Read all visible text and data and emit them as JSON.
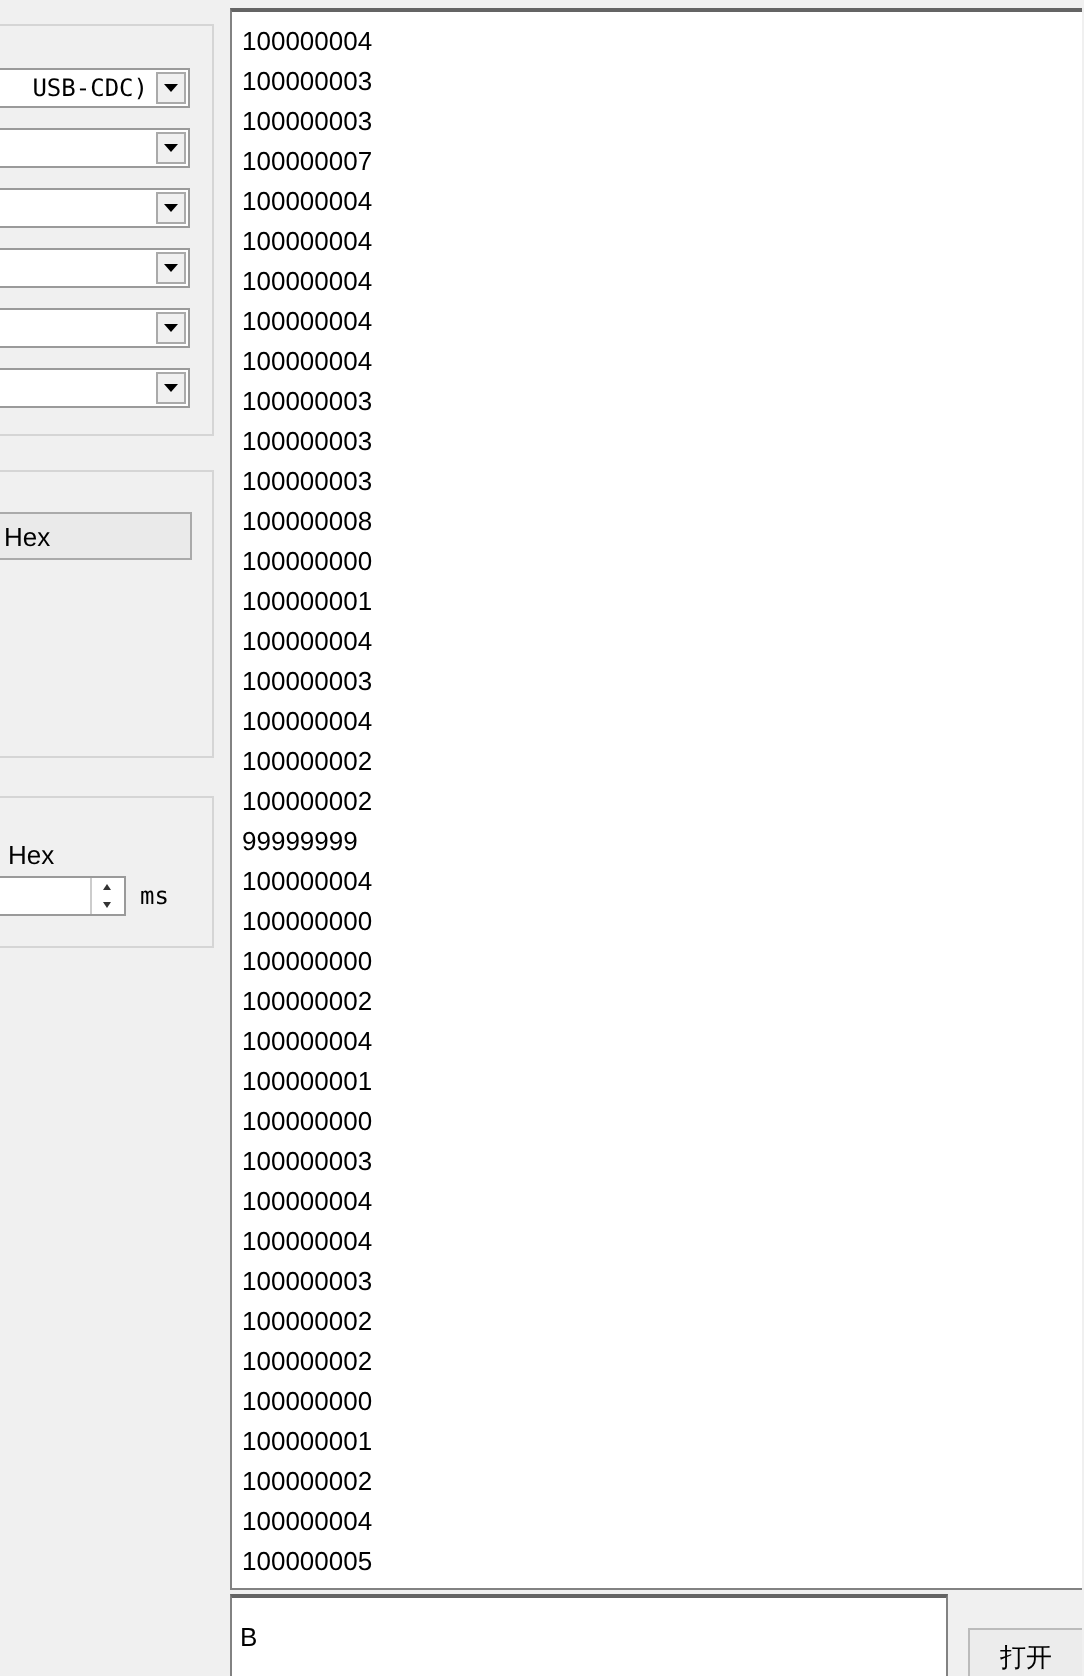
{
  "serial_settings": {
    "combos": [
      {
        "kind": "dropdown",
        "value": "USB-CDC)"
      },
      {
        "kind": "dropdown"
      },
      {
        "kind": "dropdown"
      },
      {
        "kind": "dropdown"
      },
      {
        "kind": "dropdown"
      },
      {
        "kind": "dropdown"
      }
    ]
  },
  "receive_settings": {
    "hex_button": "Hex"
  },
  "send_settings": {
    "hex_label": "Hex",
    "interval_unit": "ms"
  },
  "receive_log": [
    "100000004",
    "100000003",
    "100000003",
    "100000007",
    "100000004",
    "100000004",
    "100000004",
    "100000004",
    "100000004",
    "100000003",
    "100000003",
    "100000003",
    "100000008",
    "100000000",
    "100000001",
    "100000004",
    "100000003",
    "100000004",
    "100000002",
    "100000002",
    "99999999",
    "100000004",
    "100000000",
    "100000000",
    "100000002",
    "100000004",
    "100000001",
    "100000000",
    "100000003",
    "100000004",
    "100000004",
    "100000003",
    "100000002",
    "100000002",
    "100000000",
    "100000001",
    "100000002",
    "100000004",
    "100000005"
  ],
  "send_input": {
    "value": "B"
  },
  "open_button": "打开"
}
